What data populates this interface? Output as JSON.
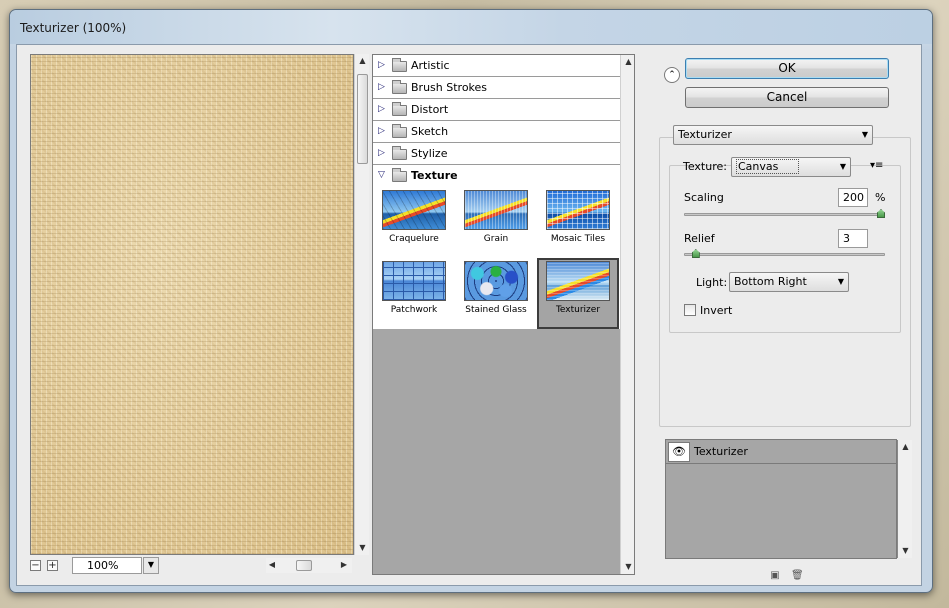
{
  "window": {
    "title": "Texturizer (100%)"
  },
  "preview": {
    "zoom": "100%",
    "zoom_out": "−",
    "zoom_in": "+"
  },
  "categories": [
    {
      "label": "Artistic",
      "open": false
    },
    {
      "label": "Brush Strokes",
      "open": false
    },
    {
      "label": "Distort",
      "open": false
    },
    {
      "label": "Sketch",
      "open": false
    },
    {
      "label": "Stylize",
      "open": false
    },
    {
      "label": "Texture",
      "open": true
    }
  ],
  "texture_filters": [
    {
      "label": "Craquelure",
      "selected": false
    },
    {
      "label": "Grain",
      "selected": false
    },
    {
      "label": "Mosaic Tiles",
      "selected": false
    },
    {
      "label": "Patchwork",
      "selected": false
    },
    {
      "label": "Stained Glass",
      "selected": false
    },
    {
      "label": "Texturizer",
      "selected": true
    }
  ],
  "buttons": {
    "ok": "OK",
    "cancel": "Cancel"
  },
  "filter_select": {
    "value": "Texturizer"
  },
  "settings": {
    "texture_label": "Texture:",
    "texture_value": "Canvas",
    "scaling_label": "Scaling",
    "scaling_value": "200",
    "scaling_unit": "%",
    "scaling_level": 1.0,
    "relief_label": "Relief",
    "relief_value": "3",
    "relief_level": 0.06,
    "light_label": "Light:",
    "light_value": "Bottom Right",
    "invert_label": "Invert",
    "invert_checked": false
  },
  "effect_layers": [
    {
      "label": "Texturizer"
    }
  ],
  "icons": {
    "collapse": "double-chevron-up-icon",
    "folder": "folder-icon",
    "expand": "triangle-right-icon",
    "eye": "eye-icon",
    "new_layer": "new-effect-layer-icon",
    "delete": "trash-icon",
    "menu": "panel-menu-icon"
  }
}
